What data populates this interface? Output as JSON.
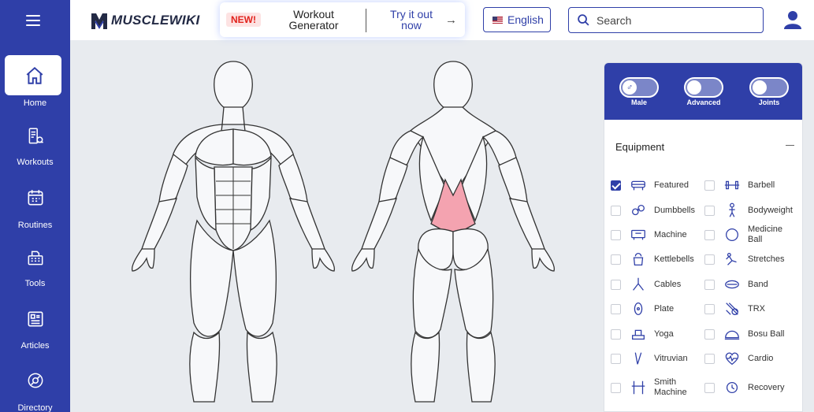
{
  "sidebar": {
    "items": [
      {
        "label": "Home"
      },
      {
        "label": "Workouts"
      },
      {
        "label": "Routines"
      },
      {
        "label": "Tools"
      },
      {
        "label": "Articles"
      },
      {
        "label": "Directory"
      }
    ]
  },
  "header": {
    "logo_text": "MUSCLEWIKI",
    "promo": {
      "badge": "NEW!",
      "title": "Workout Generator",
      "cta": "Try it out now"
    },
    "language": "English",
    "search_placeholder": "Search"
  },
  "panel": {
    "toggles": [
      {
        "label": "Male",
        "icon": "♂"
      },
      {
        "label": "Advanced",
        "icon": ""
      },
      {
        "label": "Joints",
        "icon": ""
      }
    ],
    "equipment_title": "Equipment",
    "equipment": [
      {
        "label": "Featured",
        "checked": true,
        "icon": "featured-icon"
      },
      {
        "label": "Barbell",
        "checked": false,
        "icon": "barbell-icon"
      },
      {
        "label": "Dumbbells",
        "checked": false,
        "icon": "dumbbell-icon"
      },
      {
        "label": "Bodyweight",
        "checked": false,
        "icon": "bodyweight-icon"
      },
      {
        "label": "Machine",
        "checked": false,
        "icon": "machine-icon"
      },
      {
        "label": "Medicine Ball",
        "checked": false,
        "icon": "medicine-ball-icon"
      },
      {
        "label": "Kettlebells",
        "checked": false,
        "icon": "kettlebell-icon"
      },
      {
        "label": "Stretches",
        "checked": false,
        "icon": "stretches-icon"
      },
      {
        "label": "Cables",
        "checked": false,
        "icon": "cables-icon"
      },
      {
        "label": "Band",
        "checked": false,
        "icon": "band-icon"
      },
      {
        "label": "Plate",
        "checked": false,
        "icon": "plate-icon"
      },
      {
        "label": "TRX",
        "checked": false,
        "icon": "trx-icon"
      },
      {
        "label": "Yoga",
        "checked": false,
        "icon": "yoga-icon"
      },
      {
        "label": "Bosu Ball",
        "checked": false,
        "icon": "bosu-ball-icon"
      },
      {
        "label": "Vitruvian",
        "checked": false,
        "icon": "vitruvian-icon"
      },
      {
        "label": "Cardio",
        "checked": false,
        "icon": "cardio-icon"
      },
      {
        "label": "Smith Machine",
        "checked": false,
        "icon": "smith-machine-icon"
      },
      {
        "label": "Recovery",
        "checked": false,
        "icon": "recovery-icon"
      }
    ]
  },
  "colors": {
    "brand": "#2f3fa8",
    "highlight_muscle": "#f4a3b0",
    "background": "#e8ebef"
  }
}
